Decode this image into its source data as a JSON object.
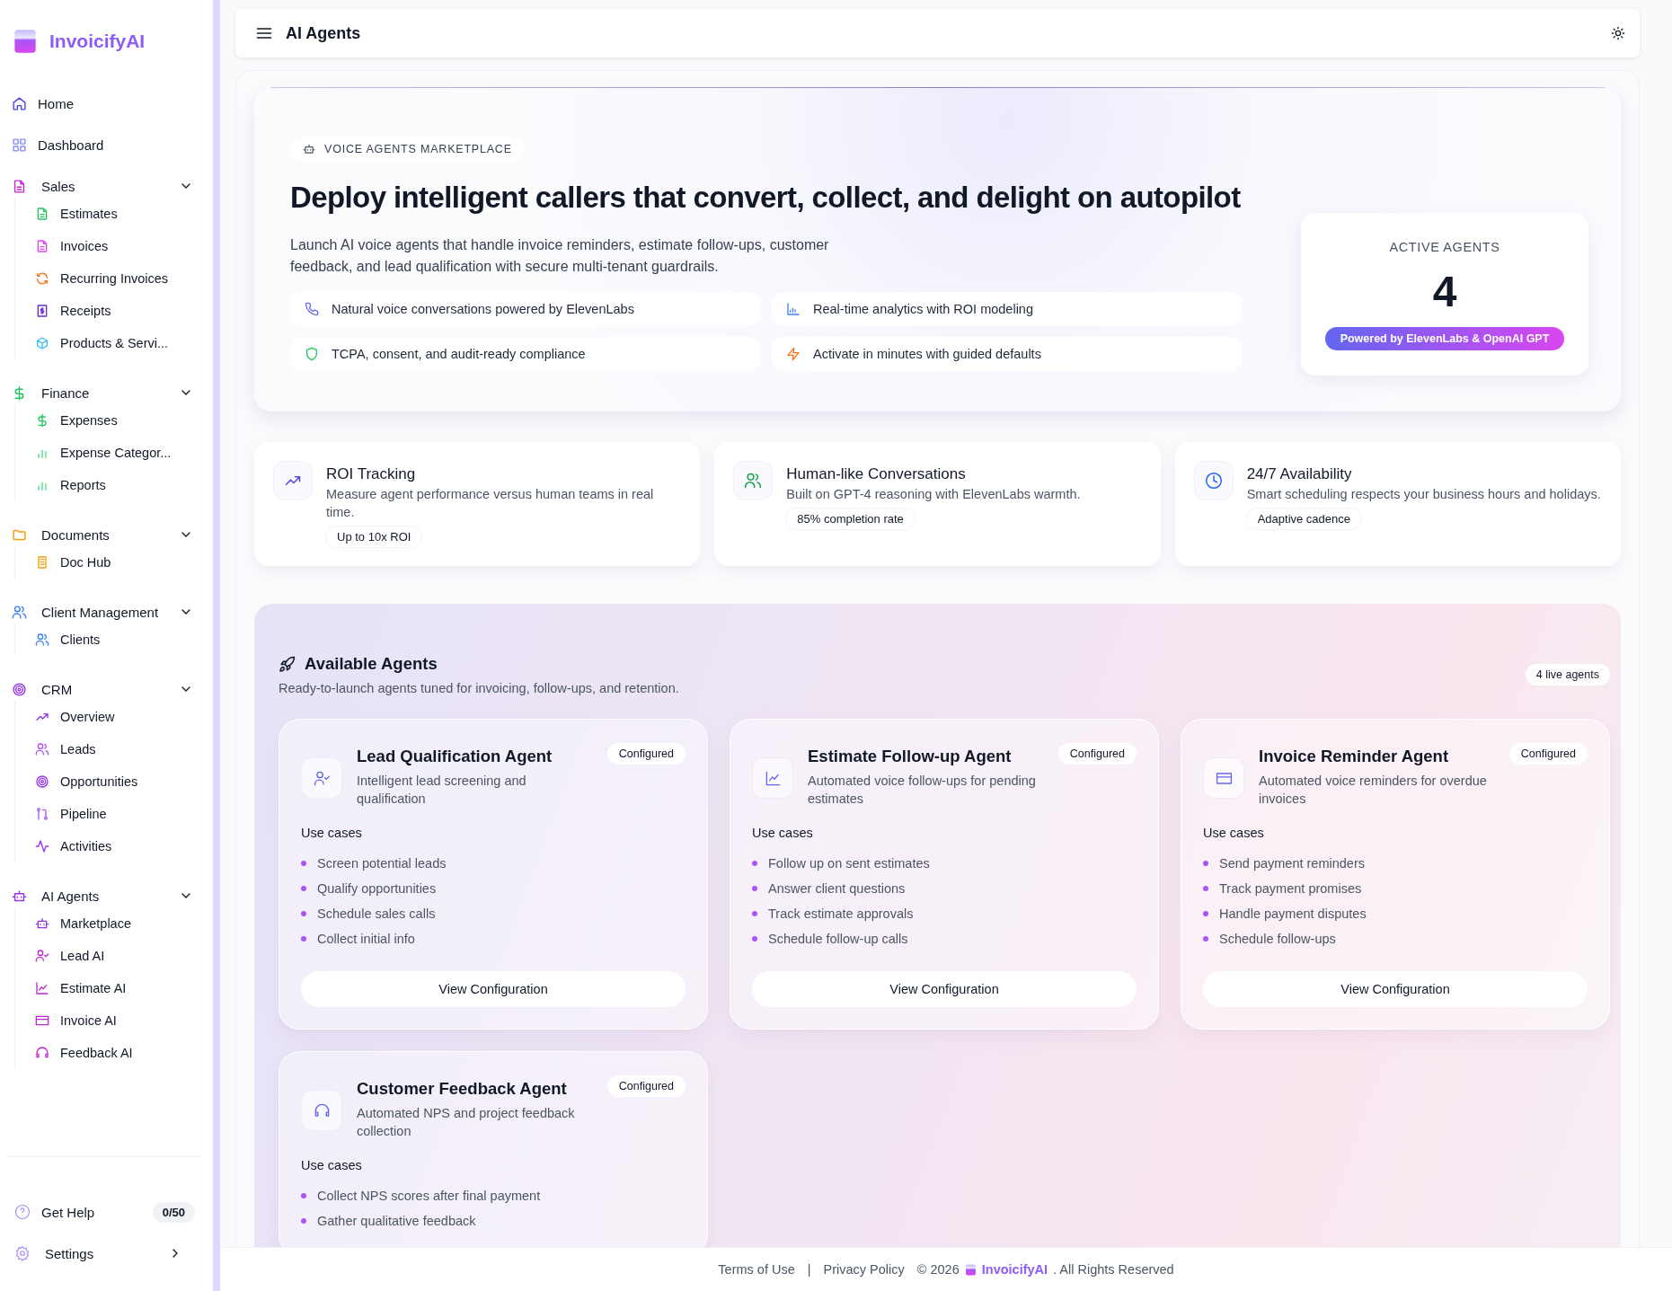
{
  "brand": {
    "name": "InvoicifyAI"
  },
  "sidebar": {
    "items": [
      {
        "kind": "link",
        "label": "Home"
      },
      {
        "kind": "link",
        "label": "Dashboard"
      },
      {
        "kind": "group",
        "label": "Sales",
        "expanded": true,
        "children": [
          {
            "label": "Estimates"
          },
          {
            "label": "Invoices"
          },
          {
            "label": "Recurring Invoices"
          },
          {
            "label": "Receipts"
          },
          {
            "label": "Products & Servi..."
          }
        ]
      },
      {
        "kind": "group",
        "label": "Finance",
        "expanded": true,
        "children": [
          {
            "label": "Expenses"
          },
          {
            "label": "Expense Categor..."
          },
          {
            "label": "Reports"
          }
        ]
      },
      {
        "kind": "group",
        "label": "Documents",
        "expanded": true,
        "children": [
          {
            "label": "Doc Hub"
          }
        ]
      },
      {
        "kind": "group",
        "label": "Client Management",
        "expanded": true,
        "children": [
          {
            "label": "Clients"
          }
        ]
      },
      {
        "kind": "group",
        "label": "CRM",
        "expanded": true,
        "children": [
          {
            "label": "Overview"
          },
          {
            "label": "Leads"
          },
          {
            "label": "Opportunities"
          },
          {
            "label": "Pipeline"
          },
          {
            "label": "Activities"
          }
        ]
      },
      {
        "kind": "group",
        "label": "AI Agents",
        "expanded": true,
        "children": [
          {
            "label": "Marketplace"
          },
          {
            "label": "Lead AI"
          },
          {
            "label": "Estimate AI"
          },
          {
            "label": "Invoice AI"
          },
          {
            "label": "Feedback AI"
          }
        ]
      }
    ],
    "help": {
      "label": "Get Help",
      "count": "0/50"
    },
    "settings": {
      "label": "Settings"
    }
  },
  "header": {
    "title": "AI Agents"
  },
  "hero": {
    "badge": "VOICE AGENTS MARKETPLACE",
    "title": "Deploy intelligent callers that convert, collect, and delight on autopilot",
    "description": "Launch AI voice agents that handle invoice reminders, estimate follow-ups, customer feedback, and lead qualification with secure multi-tenant guardrails.",
    "features": [
      "Natural voice conversations powered by ElevenLabs",
      "Real-time analytics with ROI modeling",
      "TCPA, consent, and audit-ready compliance",
      "Activate in minutes with guided defaults"
    ],
    "stat": {
      "label": "ACTIVE AGENTS",
      "value": "4",
      "pill": "Powered by ElevenLabs & OpenAI GPT"
    }
  },
  "highlights": [
    {
      "title": "ROI Tracking",
      "description": "Measure agent performance versus human teams in real time.",
      "tag": "Up to 10x ROI"
    },
    {
      "title": "Human-like Conversations",
      "description": "Built on GPT-4 reasoning with ElevenLabs warmth.",
      "tag": "85% completion rate"
    },
    {
      "title": "24/7 Availability",
      "description": "Smart scheduling respects your business hours and holidays.",
      "tag": "Adaptive cadence"
    }
  ],
  "agents_section": {
    "title": "Available Agents",
    "subtitle": "Ready-to-launch agents tuned for invoicing, follow-ups, and retention.",
    "count_badge": "4 live agents",
    "agents": [
      {
        "name": "Lead Qualification Agent",
        "description": "Intelligent lead screening and qualification",
        "status": "Configured",
        "use_cases_label": "Use cases",
        "use_cases": [
          "Screen potential leads",
          "Qualify opportunities",
          "Schedule sales calls",
          "Collect initial info"
        ],
        "button": "View Configuration"
      },
      {
        "name": "Estimate Follow-up Agent",
        "description": "Automated voice follow-ups for pending estimates",
        "status": "Configured",
        "use_cases_label": "Use cases",
        "use_cases": [
          "Follow up on sent estimates",
          "Answer client questions",
          "Track estimate approvals",
          "Schedule follow-up calls"
        ],
        "button": "View Configuration"
      },
      {
        "name": "Invoice Reminder Agent",
        "description": "Automated voice reminders for overdue invoices",
        "status": "Configured",
        "use_cases_label": "Use cases",
        "use_cases": [
          "Send payment reminders",
          "Track payment promises",
          "Handle payment disputes",
          "Schedule follow-ups"
        ],
        "button": "View Configuration"
      },
      {
        "name": "Customer Feedback Agent",
        "description": "Automated NPS and project feedback collection",
        "status": "Configured",
        "use_cases_label": "Use cases",
        "use_cases": [
          "Collect NPS scores after final payment",
          "Gather qualitative feedback"
        ]
      }
    ]
  },
  "footer": {
    "links": [
      "Terms of Use",
      "Privacy Policy"
    ],
    "separator": "|",
    "copyright": "© 2026",
    "brand": "InvoicifyAI",
    "rights": ". All Rights Reserved"
  }
}
